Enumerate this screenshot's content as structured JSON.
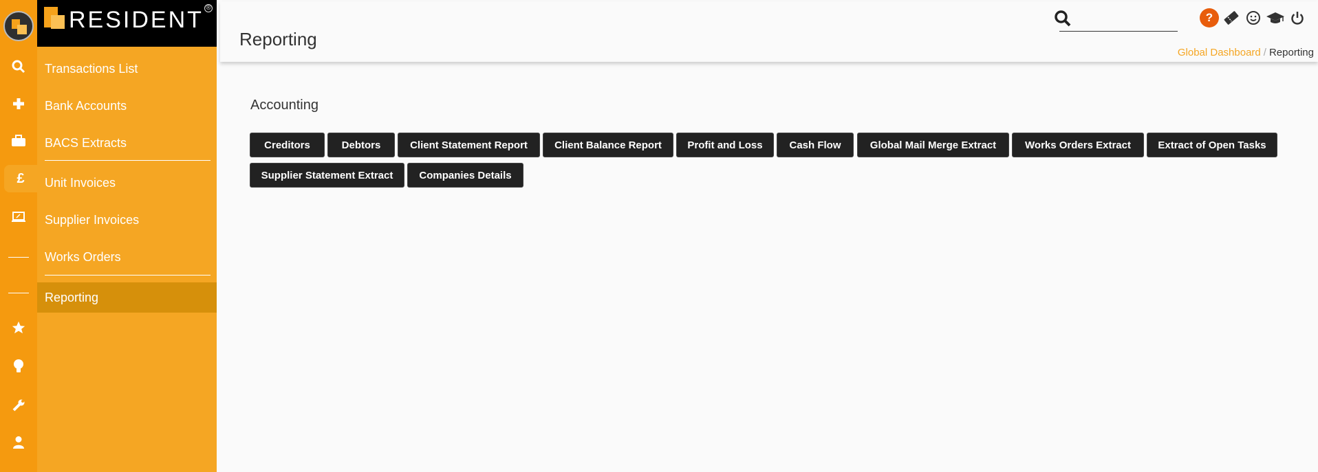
{
  "brand": {
    "name": "RESIDENT",
    "reg": "®"
  },
  "rail": {
    "icons": [
      "logo-icon",
      "search-icon",
      "plus-icon",
      "briefcase-icon",
      "pound-icon",
      "monitor-icon",
      "star-icon",
      "lightbulb-icon",
      "wrench-icon",
      "user-icon"
    ],
    "pound_glyph": "£"
  },
  "sidebar": {
    "items": [
      {
        "label": "Transactions List"
      },
      {
        "label": "Bank Accounts"
      },
      {
        "label": "BACS Extracts"
      },
      {
        "label": "Unit Invoices"
      },
      {
        "label": "Supplier Invoices"
      },
      {
        "label": "Works Orders"
      },
      {
        "label": "Reporting"
      }
    ],
    "active": "Reporting"
  },
  "header": {
    "title": "Reporting",
    "search_placeholder": "",
    "help_glyph": "?",
    "icons": [
      "help-icon",
      "ticket-icon",
      "smiley-icon",
      "graduation-cap-icon",
      "power-icon"
    ]
  },
  "breadcrumb": {
    "link": "Global Dashboard",
    "separator": "/",
    "current": "Reporting"
  },
  "main": {
    "section_title": "Accounting",
    "buttons": [
      "Creditors",
      "Debtors",
      "Client Statement Report",
      "Client Balance Report",
      "Profit and Loss",
      "Cash Flow",
      "Global Mail Merge Extract",
      "Works Orders Extract",
      "Extract of Open Tasks",
      "Supplier Statement Extract",
      "Companies Details"
    ]
  },
  "colors": {
    "accent": "#f5a623",
    "rail": "#f59a0f",
    "active": "#d6900b",
    "button": "#222222",
    "help": "#e85d0c"
  }
}
